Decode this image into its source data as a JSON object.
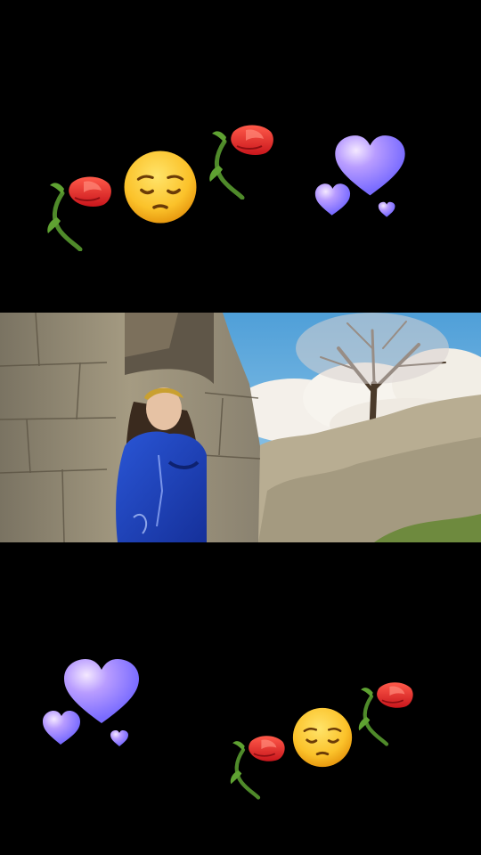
{
  "screen": {
    "background": "#000000"
  },
  "stickers_top": [
    {
      "icon": "rose-icon"
    },
    {
      "icon": "pensive-face-icon"
    },
    {
      "icon": "rose-icon"
    },
    {
      "icon": "purple-hearts-icon"
    }
  ],
  "video": {
    "scene": "woman-in-blue-dress-by-stone-wall-with-tree-on-hill",
    "colors": {
      "sky": "#6fb4e0",
      "cloud": "#f4f0ea",
      "rock": "#b8ad92",
      "dress": "#1f3fb0"
    }
  },
  "stickers_bottom": [
    {
      "icon": "purple-hearts-icon"
    },
    {
      "icon": "rose-icon"
    },
    {
      "icon": "pensive-face-icon"
    },
    {
      "icon": "rose-icon"
    }
  ]
}
